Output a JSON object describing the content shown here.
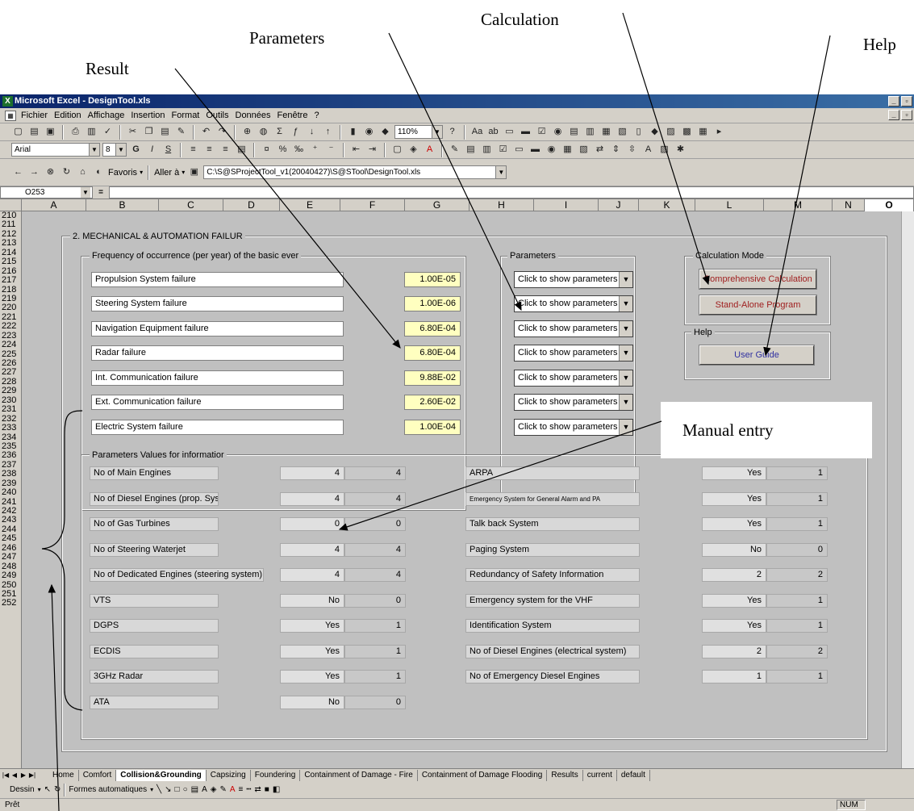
{
  "annotations": {
    "result": "Result",
    "parameters": "Parameters",
    "calculation": "Calculation",
    "help": "Help",
    "manual_entry": "Manual entry"
  },
  "window": {
    "title": "Microsoft Excel - DesignTool.xls",
    "app_icon": "excel-icon"
  },
  "menu": [
    "Fichier",
    "Edition",
    "Affichage",
    "Insertion",
    "Format",
    "Outils",
    "Données",
    "Fenêtre",
    "?"
  ],
  "toolbar": {
    "zoom": "110%",
    "font": "Arial",
    "font_size": "8",
    "favoris": "Favoris",
    "aller_a": "Aller à",
    "address": "C:\\S@SProjectTool_v1(20040427)\\S@STool\\DesignTool.xls"
  },
  "formula_bar": {
    "cell": "O253",
    "equals": "="
  },
  "columns": [
    "A",
    "B",
    "C",
    "D",
    "E",
    "F",
    "G",
    "H",
    "I",
    "J",
    "K",
    "L",
    "M",
    "N",
    "O"
  ],
  "rows": [
    "210",
    "211",
    "212",
    "213",
    "214",
    "215",
    "216",
    "217",
    "218",
    "219",
    "220",
    "221",
    "222",
    "223",
    "224",
    "225",
    "226",
    "227",
    "228",
    "229",
    "230",
    "231",
    "232",
    "233",
    "234",
    "235",
    "236",
    "237",
    "238",
    "239",
    "240",
    "241",
    "242",
    "243",
    "244",
    "245",
    "246",
    "247",
    "248",
    "249",
    "250",
    "251",
    "252"
  ],
  "section": {
    "title": "2. MECHANICAL & AUTOMATION FAILUR",
    "frequency_title": "Frequency of occurrence (per year) of the basic ever",
    "failures": [
      {
        "label": "Propulsion System failure",
        "value": "1.00E-05"
      },
      {
        "label": "Steering System failure",
        "value": "1.00E-06"
      },
      {
        "label": "Navigation Equipment failure",
        "value": "6.80E-04"
      },
      {
        "label": "Radar failure",
        "value": "6.80E-04"
      },
      {
        "label": "Int. Communication failure",
        "value": "9.88E-02"
      },
      {
        "label": "Ext. Communication failure",
        "value": "2.60E-02"
      },
      {
        "label": "Electric System failure",
        "value": "1.00E-04"
      }
    ],
    "parameters_title": "Parameters",
    "param_select_label": "Click to show parameters",
    "calc_title": "Calculation Mode",
    "calc_buttons": [
      "Comprehensive Calculation",
      "Stand-Alone Program"
    ],
    "help_title": "Help",
    "help_button": "User Guide",
    "info_title": "Parameters Values for informatior",
    "left_params": [
      {
        "label": "No of Main Engines",
        "v1": "4",
        "v2": "4"
      },
      {
        "label": "No of Diesel Engines (prop. Syst)",
        "v1": "4",
        "v2": "4"
      },
      {
        "label": "No of Gas Turbines",
        "v1": "0",
        "v2": "0"
      },
      {
        "label": "No of Steering Waterjet",
        "v1": "4",
        "v2": "4"
      },
      {
        "label": "No of Dedicated Engines (steering system)",
        "v1": "4",
        "v2": "4"
      },
      {
        "label": "VTS",
        "v1": "No",
        "v2": "0"
      },
      {
        "label": "DGPS",
        "v1": "Yes",
        "v2": "1"
      },
      {
        "label": "ECDIS",
        "v1": "Yes",
        "v2": "1"
      },
      {
        "label": "3GHz Radar",
        "v1": "Yes",
        "v2": "1"
      },
      {
        "label": "ATA",
        "v1": "No",
        "v2": "0"
      }
    ],
    "right_params": [
      {
        "label": "ARPA",
        "v1": "Yes",
        "v2": "1"
      },
      {
        "label": "Emergency System for General Alarm and PA",
        "v1": "Yes",
        "v2": "1"
      },
      {
        "label": "Talk back System",
        "v1": "Yes",
        "v2": "1"
      },
      {
        "label": "Paging System",
        "v1": "No",
        "v2": "0"
      },
      {
        "label": "Redundancy of Safety Information",
        "v1": "2",
        "v2": "2"
      },
      {
        "label": "Emergency system for the VHF",
        "v1": "Yes",
        "v2": "1"
      },
      {
        "label": "Identification System",
        "v1": "Yes",
        "v2": "1"
      },
      {
        "label": "No of Diesel Engines (electrical system)",
        "v1": "2",
        "v2": "2"
      },
      {
        "label": "No of Emergency Diesel Engines",
        "v1": "1",
        "v2": "1"
      }
    ]
  },
  "tabs": [
    "Home",
    "Comfort",
    "Collision&Grounding",
    "Capsizing",
    "Foundering",
    "Containment of Damage - Fire",
    "Containment of Damage Flooding",
    "Results",
    "current",
    "default"
  ],
  "active_tab": "Collision&Grounding",
  "drawing_toolbar": {
    "dessin": "Dessin",
    "formes": "Formes automatiques"
  },
  "status": {
    "text": "Prêt",
    "num": "NUM"
  }
}
